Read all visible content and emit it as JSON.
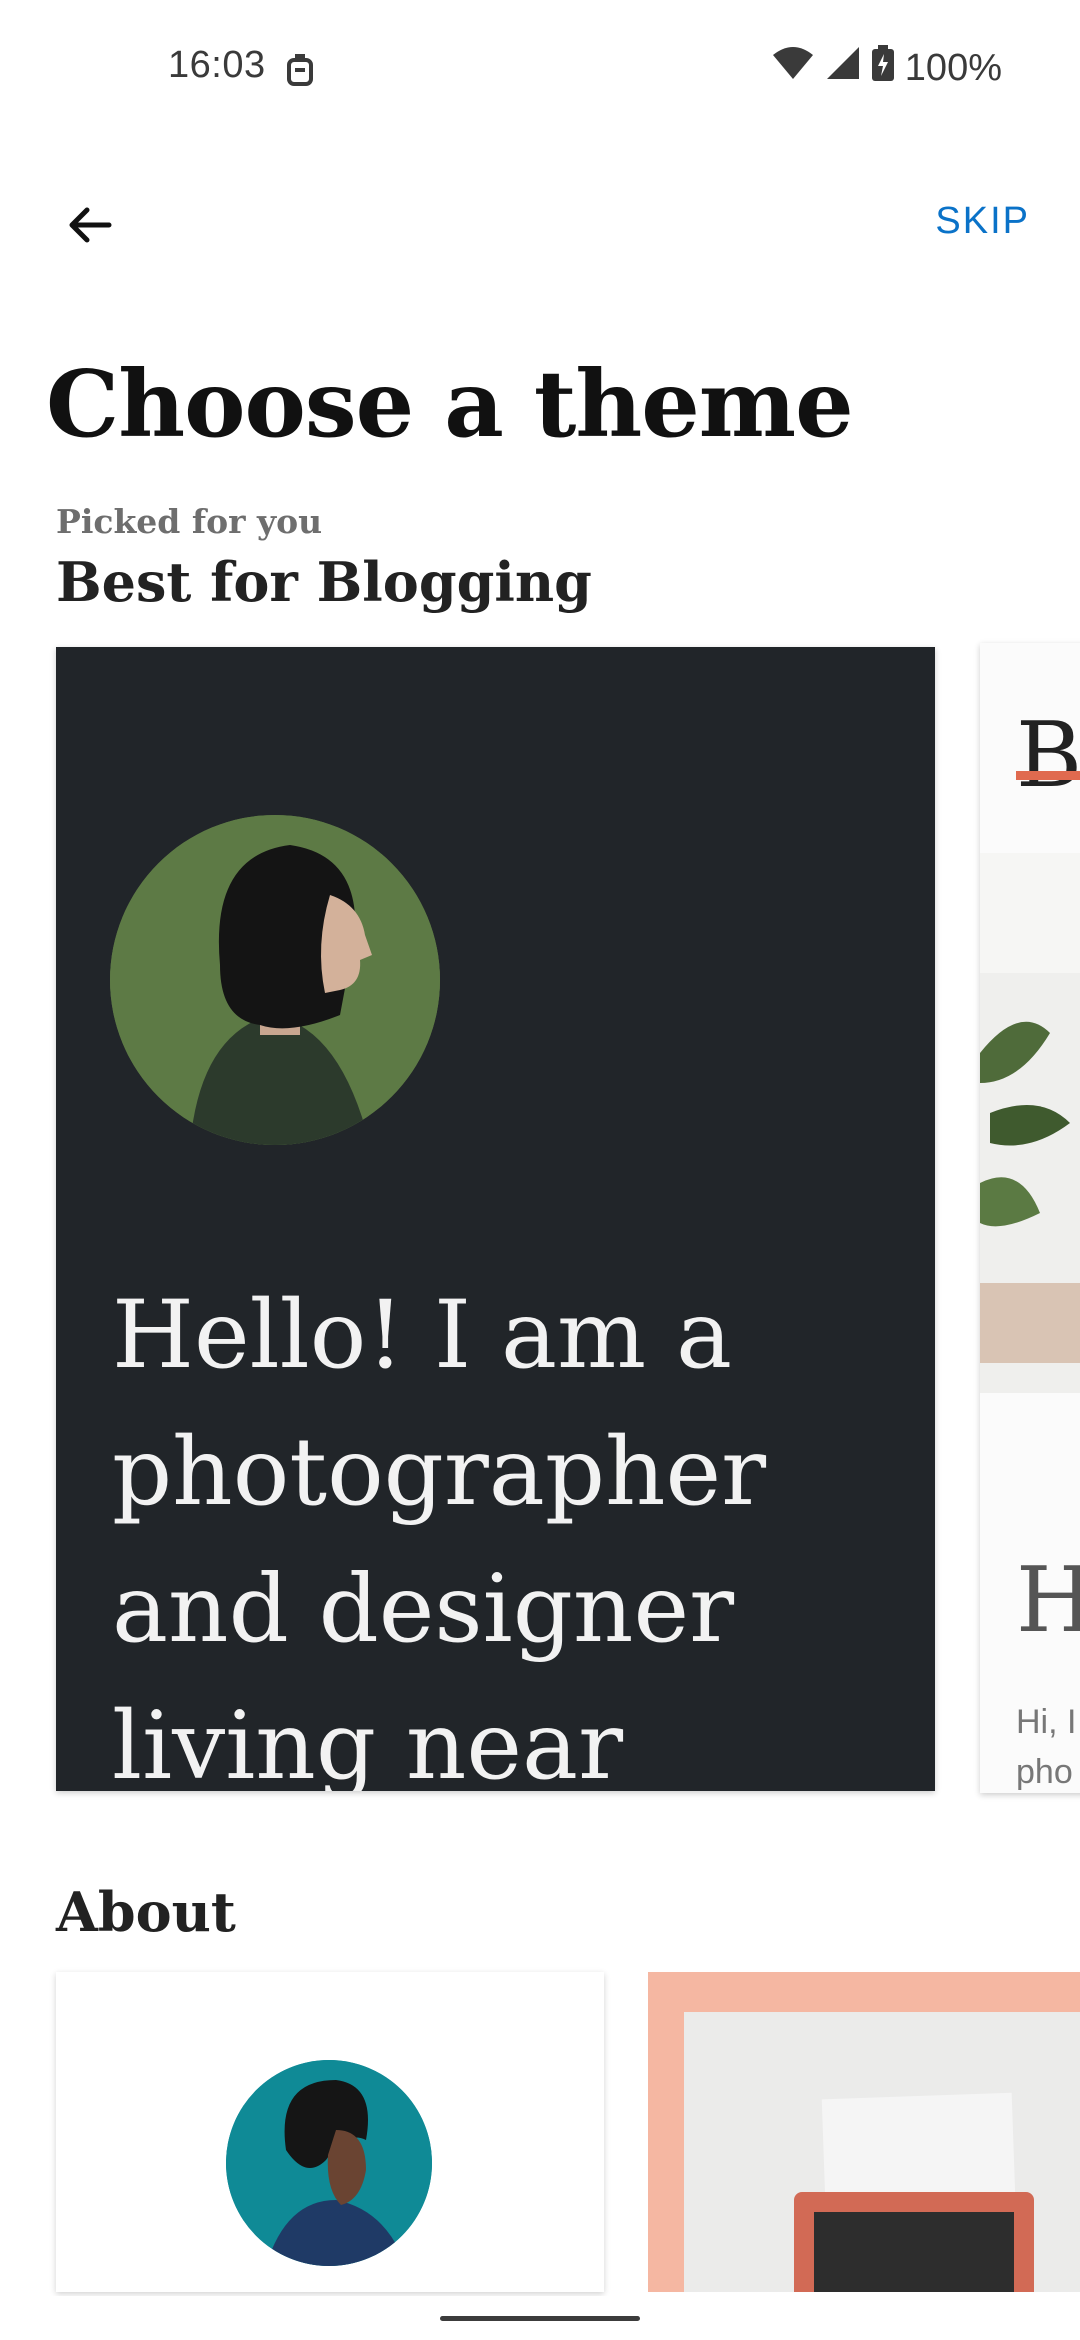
{
  "status_bar": {
    "time": "16:03",
    "battery_text": "100%",
    "icons": [
      "notification-icon",
      "wifi-icon",
      "signal-icon",
      "battery-icon"
    ]
  },
  "app_bar": {
    "back_icon": "arrow-left-icon",
    "skip_label": "SKIP"
  },
  "page": {
    "title": "Choose a theme"
  },
  "featured_section": {
    "subheading": "Picked for you",
    "heading": "Best for Blogging",
    "cards": [
      {
        "text": "Hello! I am a photographer and designer living near"
      },
      {
        "logo_fragment": "BO",
        "heading_fragment": "H",
        "text_fragment": "Hi, I",
        "text_fragment_2": "pho"
      }
    ]
  },
  "about_section": {
    "heading": "About"
  },
  "colors": {
    "accent": "#0a72c8",
    "card_dark": "#212529",
    "peach": "#f5b7a2"
  }
}
